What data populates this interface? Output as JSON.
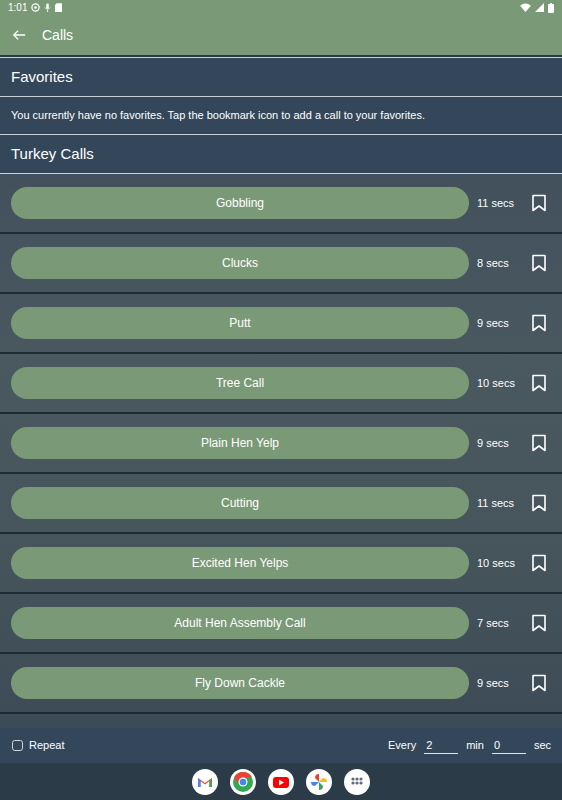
{
  "status_bar": {
    "time": "1:01"
  },
  "app_bar": {
    "title": "Calls"
  },
  "favorites": {
    "title": "Favorites",
    "empty_message": "You currently have no favorites. Tap the bookmark icon to add a call to your favorites."
  },
  "calls_section": {
    "title": "Turkey Calls"
  },
  "calls": [
    {
      "label": "Gobbling",
      "duration": "11 secs",
      "bookmarked": false
    },
    {
      "label": "Clucks",
      "duration": "8 secs",
      "bookmarked": false
    },
    {
      "label": "Putt",
      "duration": "9 secs",
      "bookmarked": false
    },
    {
      "label": "Tree Call",
      "duration": "10 secs",
      "bookmarked": false
    },
    {
      "label": "Plain Hen Yelp",
      "duration": "9 secs",
      "bookmarked": false
    },
    {
      "label": "Cutting",
      "duration": "11 secs",
      "bookmarked": false
    },
    {
      "label": "Excited Hen Yelps",
      "duration": "10 secs",
      "bookmarked": false
    },
    {
      "label": "Adult Hen Assembly Call",
      "duration": "7 secs",
      "bookmarked": false
    },
    {
      "label": "Fly Down Cackle",
      "duration": "9 secs",
      "bookmarked": false
    }
  ],
  "repeat": {
    "label": "Repeat",
    "checked": false,
    "every_label": "Every",
    "minutes": "2",
    "min_label": "min",
    "seconds": "0",
    "sec_label": "sec"
  }
}
